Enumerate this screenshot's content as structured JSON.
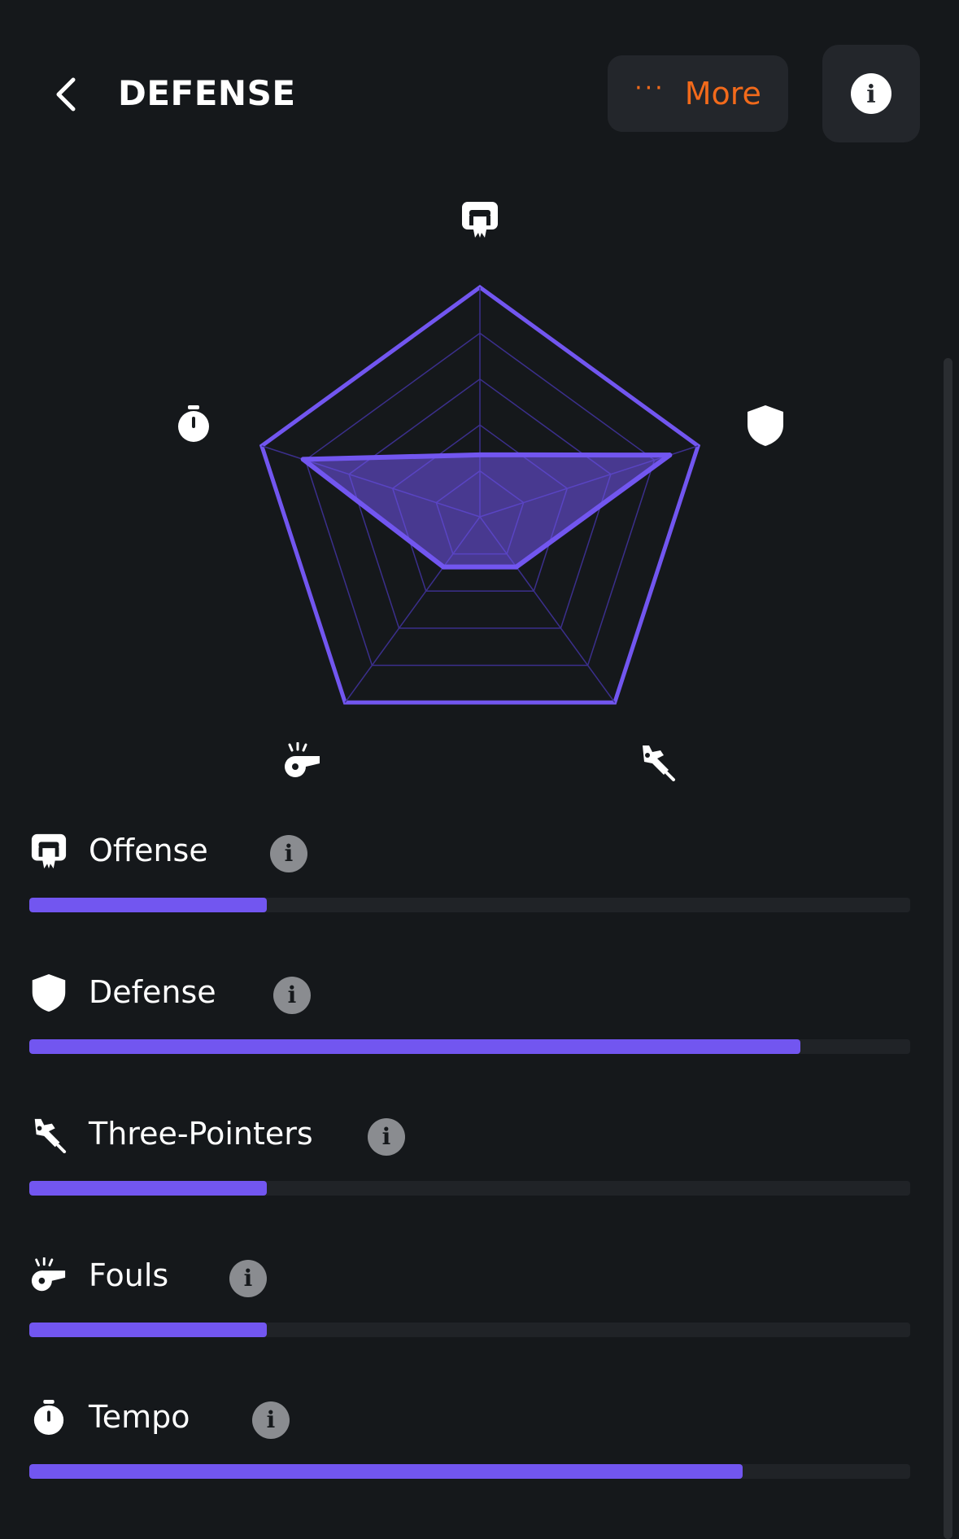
{
  "header": {
    "title": "DEFENSE",
    "more_label": "More",
    "more_dots": "···"
  },
  "colors": {
    "background": "#15181b",
    "accent_orange": "#f26a1b",
    "accent_purple": "#7256f0",
    "track": "#202327"
  },
  "chart_data": {
    "type": "radar",
    "max": 1,
    "axes": [
      {
        "name": "Offense",
        "icon": "offense-icon",
        "value": 0.27
      },
      {
        "name": "Defense",
        "icon": "shield-icon",
        "value": 0.87
      },
      {
        "name": "Three-Pointers",
        "icon": "three-pointers-icon",
        "value": 0.27
      },
      {
        "name": "Fouls",
        "icon": "whistle-icon",
        "value": 0.27
      },
      {
        "name": "Tempo",
        "icon": "stopwatch-icon",
        "value": 0.81
      }
    ],
    "rings": 5
  },
  "stats": [
    {
      "label": "Offense",
      "icon": "offense-icon",
      "value": 0.27
    },
    {
      "label": "Defense",
      "icon": "shield-icon",
      "value": 0.875
    },
    {
      "label": "Three-Pointers",
      "icon": "three-pointers-icon",
      "value": 0.27
    },
    {
      "label": "Fouls",
      "icon": "whistle-icon",
      "value": 0.27
    },
    {
      "label": "Tempo",
      "icon": "stopwatch-icon",
      "value": 0.81
    }
  ]
}
